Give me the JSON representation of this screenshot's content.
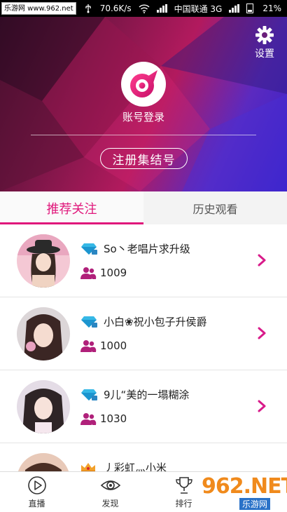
{
  "status_bar": {
    "watermark": "乐游网 www.962.net",
    "speed": "70.6K/s",
    "carrier": "中国联通 3G",
    "battery": "21%"
  },
  "header": {
    "settings_label": "设置",
    "login_label": "账号登录",
    "register_button": "注册集结号"
  },
  "tabs": [
    {
      "label": "推荐关注",
      "active": true
    },
    {
      "label": "历史观看",
      "active": false
    }
  ],
  "list": [
    {
      "name": "So丶老唱片求升级",
      "fans": "1009",
      "badge": "diamond-icon"
    },
    {
      "name": "小白❀祝小包子升侯爵",
      "fans": "1000",
      "badge": "diamond-icon"
    },
    {
      "name": "9儿“美的一塌糊涂",
      "fans": "1030",
      "badge": "diamond-icon"
    },
    {
      "name": "丿彩虹灬小米",
      "fans": "",
      "badge": "crown-icon"
    }
  ],
  "bottom_nav": [
    {
      "label": "直播",
      "icon": "play-icon"
    },
    {
      "label": "发现",
      "icon": "eye-icon"
    },
    {
      "label": "排行",
      "icon": "trophy-icon"
    }
  ],
  "promo": {
    "brand": "962.NET",
    "caption": "乐游网"
  },
  "colors": {
    "accent": "#e0177b",
    "header_start": "#7d1648",
    "header_end": "#3420c8"
  }
}
